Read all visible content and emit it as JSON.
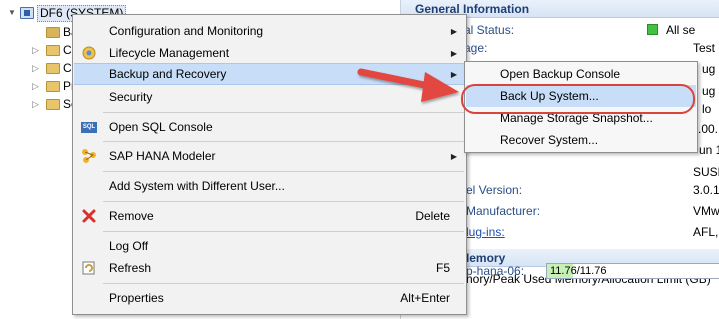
{
  "tree": {
    "root_label": "DF6 (SYSTEM)",
    "children": [
      "Ba",
      "Co",
      "Co",
      "Pr",
      "Se"
    ]
  },
  "info": {
    "general_header": "General Information",
    "rows": [
      {
        "label": "al Status:",
        "value": "All se"
      },
      {
        "label": "age:",
        "value": "Test"
      },
      {
        "label": "",
        "value": "ug"
      },
      {
        "label": "",
        "value": "ug"
      },
      {
        "label": "",
        "value": "lo"
      },
      {
        "label": "",
        "value": ".00."
      },
      {
        "label": "",
        "value": "un 1"
      },
      {
        "label": "",
        "value": "SUSE"
      },
      {
        "label": "el Version:",
        "value": "3.0.1"
      },
      {
        "label": "Manufacturer:",
        "value": "VMw"
      },
      {
        "label": "lug-ins:",
        "value": "AFL,"
      }
    ],
    "memory_header": "A Used Memory",
    "memory_caption": "nory/Peak Used Memory/Allocation Limit (GB)",
    "memory_host": "p-hana-06:",
    "memory_value": "11.76/11.76",
    "memory_fill_fraction": 0.15,
    "bottom_partial": "M   I f   ti"
  },
  "menu": {
    "items": [
      {
        "label": "Configuration and Monitoring",
        "shortcut": "",
        "submenu": true,
        "icon": ""
      },
      {
        "label": "Lifecycle Management",
        "shortcut": "",
        "submenu": true,
        "icon": "lifecycle-icon"
      },
      {
        "label": "Backup and Recovery",
        "shortcut": "",
        "submenu": true,
        "icon": ""
      },
      {
        "label": "Security",
        "shortcut": "",
        "submenu": false,
        "icon": ""
      },
      {
        "label": "Open SQL Console",
        "shortcut": "",
        "submenu": false,
        "icon": "sql-console-icon"
      },
      {
        "label": "SAP HANA Modeler",
        "shortcut": "",
        "submenu": true,
        "icon": "modeler-icon"
      },
      {
        "label": "Add System with Different User...",
        "shortcut": "",
        "submenu": false,
        "icon": ""
      },
      {
        "label": "Remove",
        "shortcut": "Delete",
        "submenu": false,
        "icon": "remove-icon"
      },
      {
        "label": "Log Off",
        "shortcut": "",
        "submenu": false,
        "icon": ""
      },
      {
        "label": "Refresh",
        "shortcut": "F5",
        "submenu": false,
        "icon": "refresh-icon"
      },
      {
        "label": "Properties",
        "shortcut": "Alt+Enter",
        "submenu": false,
        "icon": ""
      }
    ],
    "submenu_arrow": "▶",
    "sql_icon_text": "SQL"
  },
  "submenu": {
    "items": [
      {
        "label": "Open Backup Console"
      },
      {
        "label": "Back Up System..."
      },
      {
        "label": "Manage Storage Snapshot..."
      },
      {
        "label": "Recover System..."
      }
    ]
  },
  "colors": {
    "highlight": "#c8ddf7",
    "annotation": "#d9453d"
  }
}
